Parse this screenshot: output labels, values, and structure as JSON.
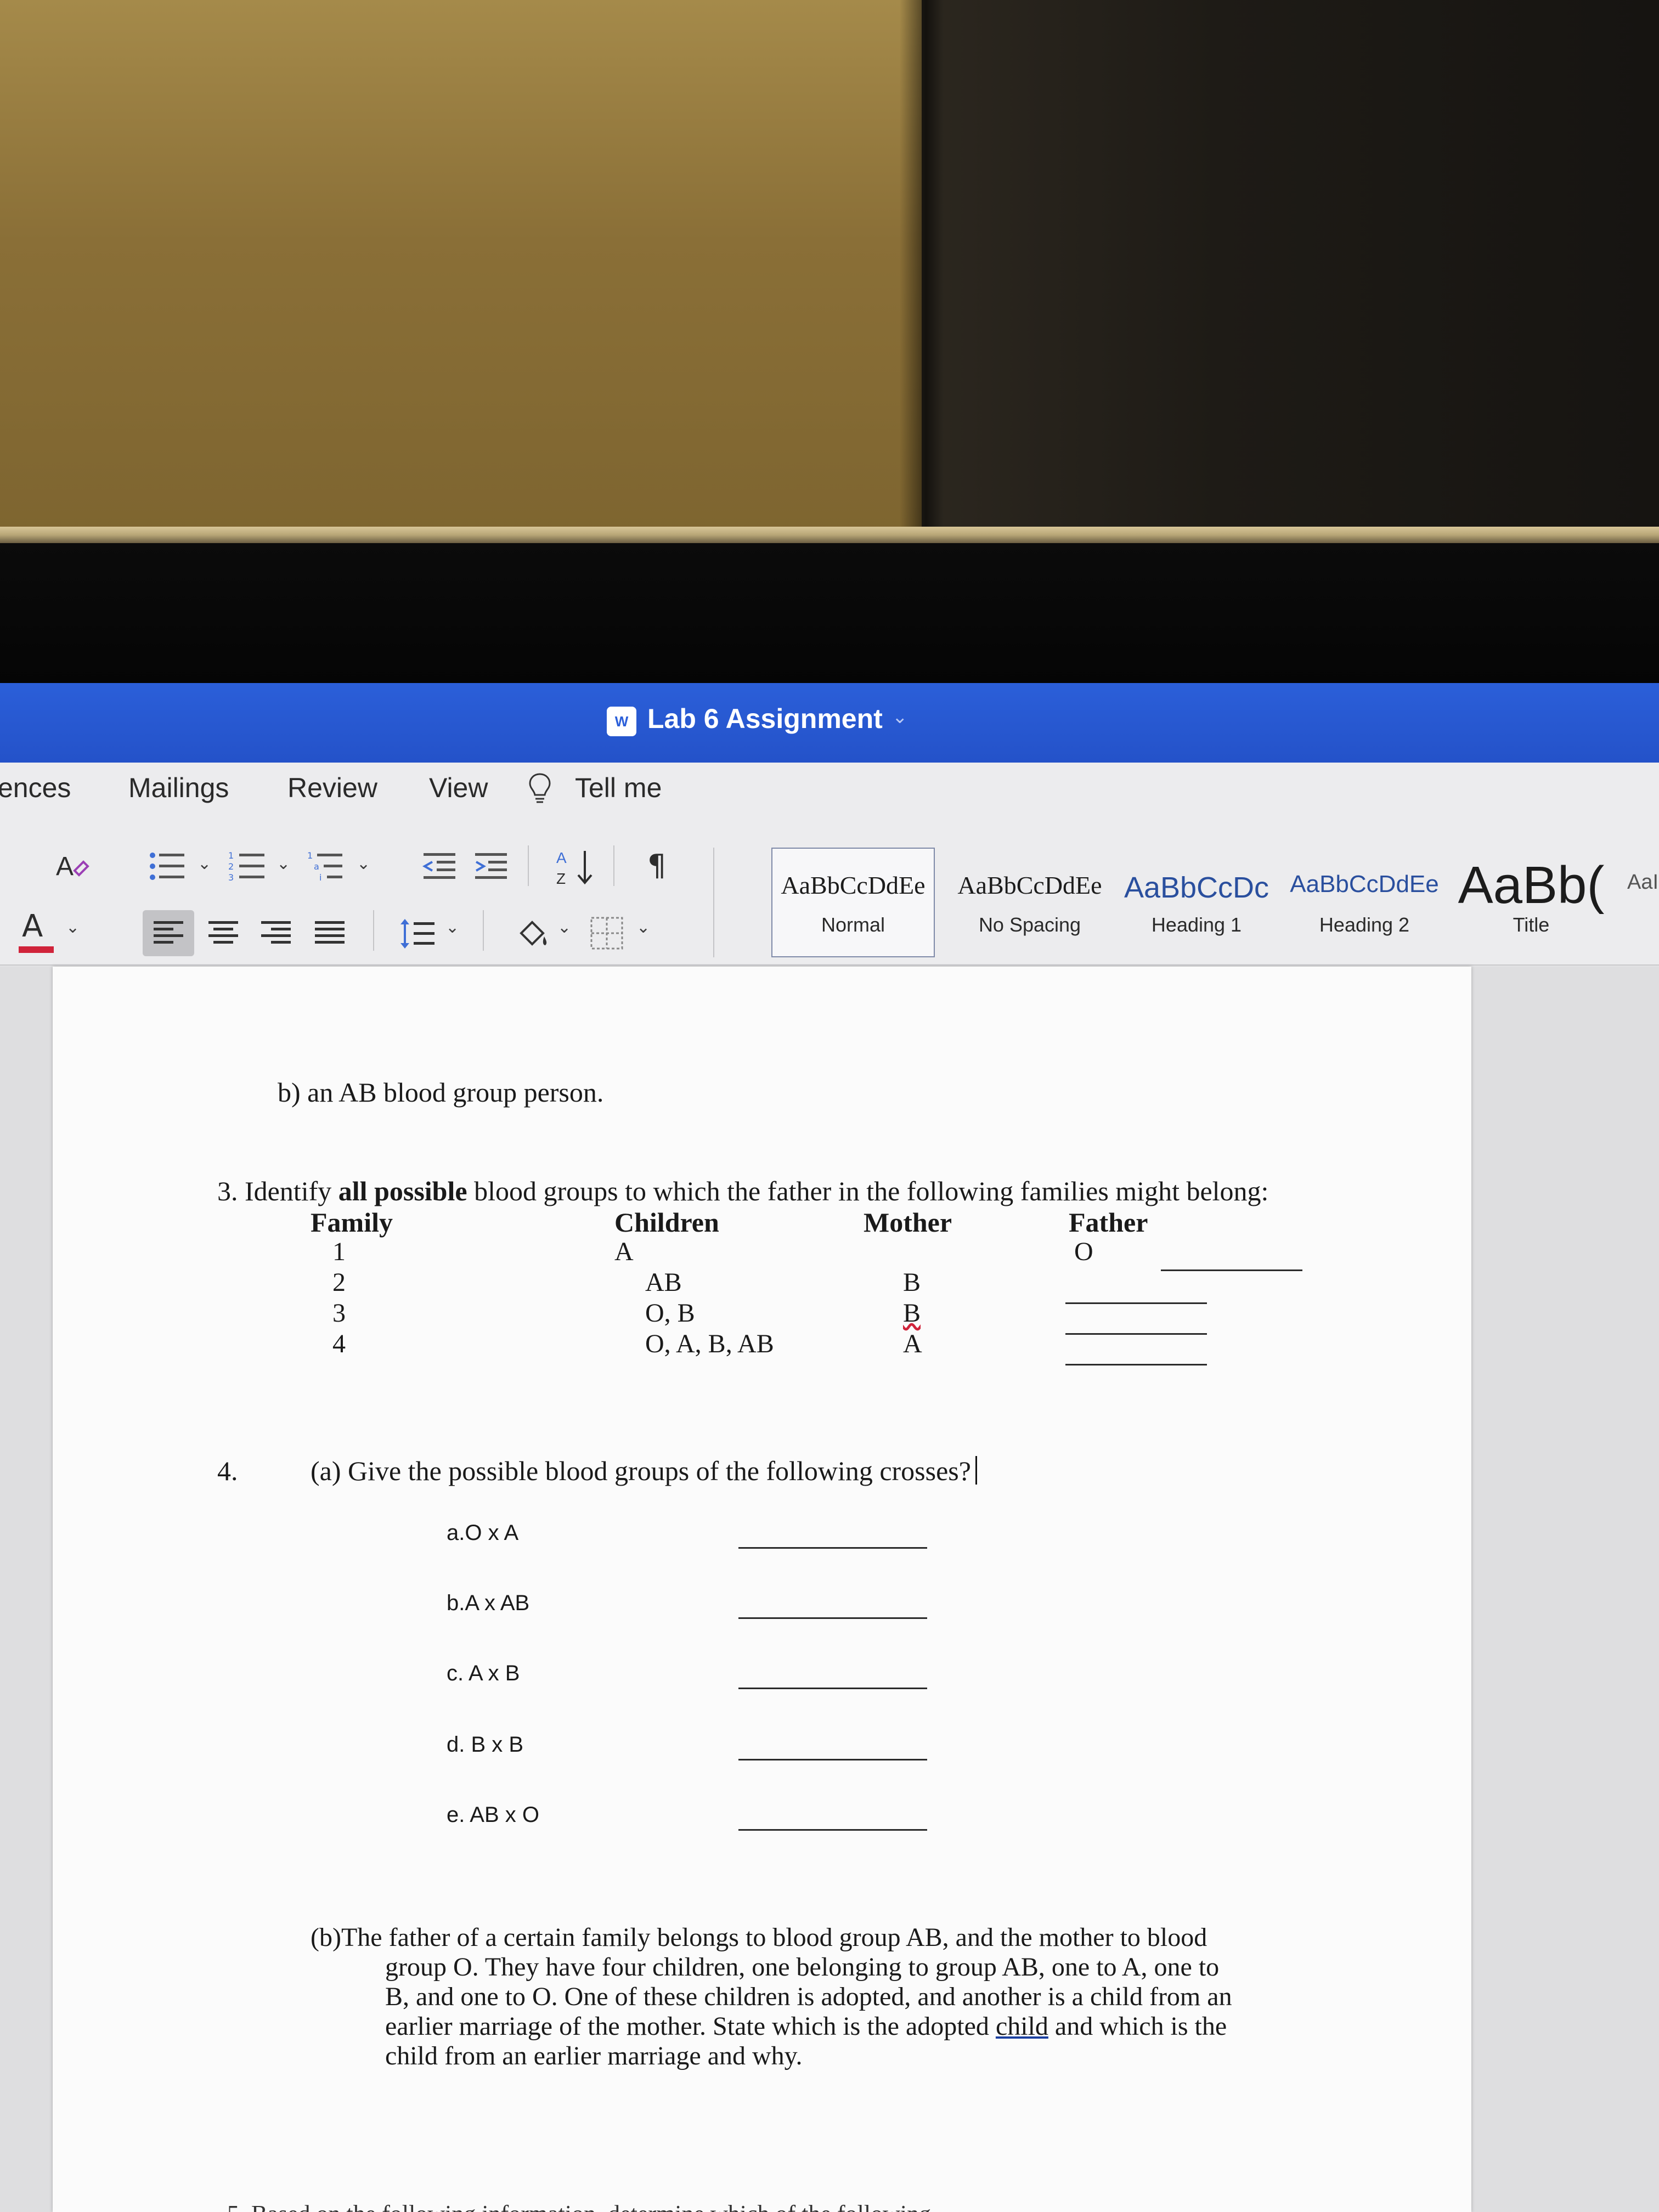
{
  "window": {
    "title": "Lab 6 Assignment",
    "word_icon": "word-app-icon",
    "title_chevron": "⌄"
  },
  "ribbon": {
    "tabs": [
      "ences",
      "Mailings",
      "Review",
      "View"
    ],
    "tell_me": "Tell me",
    "font_color_letter": "A",
    "sort_label": "A Z",
    "pilcrow": "¶",
    "styles": [
      {
        "sample": "AaBbCcDdEe",
        "name": "Normal"
      },
      {
        "sample": "AaBbCcDdEe",
        "name": "No Spacing"
      },
      {
        "sample": "AaBbCcDc",
        "name": "Heading 1"
      },
      {
        "sample": "AaBbCcDdEe",
        "name": "Heading 2"
      },
      {
        "sample": "AaBb(",
        "name": "Title"
      },
      {
        "sample": "AaI",
        "name": ""
      }
    ]
  },
  "document": {
    "q2b": "b)   an AB blood group person.",
    "q3": {
      "number": "3.",
      "prefix": "Identify ",
      "bold": "all possible",
      "suffix": " blood groups to which the father in the following families might belong:",
      "headers": [
        "Family",
        "Children",
        "Mother",
        "Father"
      ],
      "rows": [
        {
          "family": "1",
          "children": "A",
          "mother": "",
          "father": "O"
        },
        {
          "family": "2",
          "children": "AB",
          "mother": "B",
          "father": ""
        },
        {
          "family": "3",
          "children": "O, B",
          "mother": "B",
          "father": ""
        },
        {
          "family": "4",
          "children": "O, A, B, AB",
          "mother": "A",
          "father": ""
        }
      ]
    },
    "q4": {
      "number": "4.",
      "part_a": "(a) Give the possible blood groups of the following crosses?",
      "crosses": [
        "a.O x A",
        "b.A x AB",
        "c. A x B",
        "d. B x B",
        "e. AB x O"
      ],
      "part_b_lines": [
        "(b)The father of a certain family belongs to blood group AB, and the mother to blood",
        "group O.  They have four children, one belonging to group AB, one to A, one to",
        "B, and one to O.  One of these children is adopted, and another is a child from an",
        "earlier marriage of the mother.  State which is the adopted ",
        "child",
        " and which is the",
        "child from an earlier marriage and why."
      ]
    },
    "q5_partial": "5.  Based on the following information, determine which of the following ..."
  }
}
